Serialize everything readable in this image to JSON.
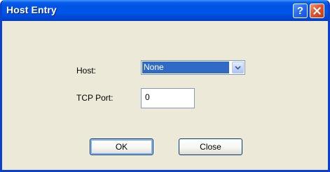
{
  "window": {
    "title": "Host Entry",
    "help_symbol": "?"
  },
  "form": {
    "host_label": "Host:",
    "host_value": "None",
    "port_label": "TCP Port:",
    "port_value": "0"
  },
  "buttons": {
    "ok_label": "OK",
    "close_label": "Close"
  },
  "icons": {
    "help": "help-icon",
    "close": "close-icon",
    "dropdown": "chevron-down-icon"
  },
  "colors": {
    "titlebar": "#0054e3",
    "dialog_bg": "#ece9d8",
    "selection": "#316ac5",
    "close_button": "#e2542c"
  }
}
